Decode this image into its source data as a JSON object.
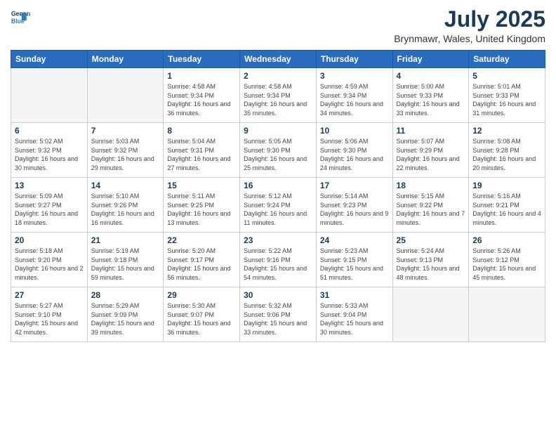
{
  "header": {
    "logo_line1": "General",
    "logo_line2": "Blue",
    "month_year": "July 2025",
    "location": "Brynmawr, Wales, United Kingdom"
  },
  "weekdays": [
    "Sunday",
    "Monday",
    "Tuesday",
    "Wednesday",
    "Thursday",
    "Friday",
    "Saturday"
  ],
  "weeks": [
    [
      {
        "day": "",
        "empty": true
      },
      {
        "day": "",
        "empty": true
      },
      {
        "day": "1",
        "sunrise": "Sunrise: 4:58 AM",
        "sunset": "Sunset: 9:34 PM",
        "daylight": "Daylight: 16 hours and 36 minutes."
      },
      {
        "day": "2",
        "sunrise": "Sunrise: 4:58 AM",
        "sunset": "Sunset: 9:34 PM",
        "daylight": "Daylight: 16 hours and 35 minutes."
      },
      {
        "day": "3",
        "sunrise": "Sunrise: 4:59 AM",
        "sunset": "Sunset: 9:34 PM",
        "daylight": "Daylight: 16 hours and 34 minutes."
      },
      {
        "day": "4",
        "sunrise": "Sunrise: 5:00 AM",
        "sunset": "Sunset: 9:33 PM",
        "daylight": "Daylight: 16 hours and 33 minutes."
      },
      {
        "day": "5",
        "sunrise": "Sunrise: 5:01 AM",
        "sunset": "Sunset: 9:33 PM",
        "daylight": "Daylight: 16 hours and 31 minutes."
      }
    ],
    [
      {
        "day": "6",
        "sunrise": "Sunrise: 5:02 AM",
        "sunset": "Sunset: 9:32 PM",
        "daylight": "Daylight: 16 hours and 30 minutes."
      },
      {
        "day": "7",
        "sunrise": "Sunrise: 5:03 AM",
        "sunset": "Sunset: 9:32 PM",
        "daylight": "Daylight: 16 hours and 29 minutes."
      },
      {
        "day": "8",
        "sunrise": "Sunrise: 5:04 AM",
        "sunset": "Sunset: 9:31 PM",
        "daylight": "Daylight: 16 hours and 27 minutes."
      },
      {
        "day": "9",
        "sunrise": "Sunrise: 5:05 AM",
        "sunset": "Sunset: 9:30 PM",
        "daylight": "Daylight: 16 hours and 25 minutes."
      },
      {
        "day": "10",
        "sunrise": "Sunrise: 5:06 AM",
        "sunset": "Sunset: 9:30 PM",
        "daylight": "Daylight: 16 hours and 24 minutes."
      },
      {
        "day": "11",
        "sunrise": "Sunrise: 5:07 AM",
        "sunset": "Sunset: 9:29 PM",
        "daylight": "Daylight: 16 hours and 22 minutes."
      },
      {
        "day": "12",
        "sunrise": "Sunrise: 5:08 AM",
        "sunset": "Sunset: 9:28 PM",
        "daylight": "Daylight: 16 hours and 20 minutes."
      }
    ],
    [
      {
        "day": "13",
        "sunrise": "Sunrise: 5:09 AM",
        "sunset": "Sunset: 9:27 PM",
        "daylight": "Daylight: 16 hours and 18 minutes."
      },
      {
        "day": "14",
        "sunrise": "Sunrise: 5:10 AM",
        "sunset": "Sunset: 9:26 PM",
        "daylight": "Daylight: 16 hours and 16 minutes."
      },
      {
        "day": "15",
        "sunrise": "Sunrise: 5:11 AM",
        "sunset": "Sunset: 9:25 PM",
        "daylight": "Daylight: 16 hours and 13 minutes."
      },
      {
        "day": "16",
        "sunrise": "Sunrise: 5:12 AM",
        "sunset": "Sunset: 9:24 PM",
        "daylight": "Daylight: 16 hours and 11 minutes."
      },
      {
        "day": "17",
        "sunrise": "Sunrise: 5:14 AM",
        "sunset": "Sunset: 9:23 PM",
        "daylight": "Daylight: 16 hours and 9 minutes."
      },
      {
        "day": "18",
        "sunrise": "Sunrise: 5:15 AM",
        "sunset": "Sunset: 9:22 PM",
        "daylight": "Daylight: 16 hours and 7 minutes."
      },
      {
        "day": "19",
        "sunrise": "Sunrise: 5:16 AM",
        "sunset": "Sunset: 9:21 PM",
        "daylight": "Daylight: 16 hours and 4 minutes."
      }
    ],
    [
      {
        "day": "20",
        "sunrise": "Sunrise: 5:18 AM",
        "sunset": "Sunset: 9:20 PM",
        "daylight": "Daylight: 16 hours and 2 minutes."
      },
      {
        "day": "21",
        "sunrise": "Sunrise: 5:19 AM",
        "sunset": "Sunset: 9:18 PM",
        "daylight": "Daylight: 15 hours and 59 minutes."
      },
      {
        "day": "22",
        "sunrise": "Sunrise: 5:20 AM",
        "sunset": "Sunset: 9:17 PM",
        "daylight": "Daylight: 15 hours and 56 minutes."
      },
      {
        "day": "23",
        "sunrise": "Sunrise: 5:22 AM",
        "sunset": "Sunset: 9:16 PM",
        "daylight": "Daylight: 15 hours and 54 minutes."
      },
      {
        "day": "24",
        "sunrise": "Sunrise: 5:23 AM",
        "sunset": "Sunset: 9:15 PM",
        "daylight": "Daylight: 15 hours and 51 minutes."
      },
      {
        "day": "25",
        "sunrise": "Sunrise: 5:24 AM",
        "sunset": "Sunset: 9:13 PM",
        "daylight": "Daylight: 15 hours and 48 minutes."
      },
      {
        "day": "26",
        "sunrise": "Sunrise: 5:26 AM",
        "sunset": "Sunset: 9:12 PM",
        "daylight": "Daylight: 15 hours and 45 minutes."
      }
    ],
    [
      {
        "day": "27",
        "sunrise": "Sunrise: 5:27 AM",
        "sunset": "Sunset: 9:10 PM",
        "daylight": "Daylight: 15 hours and 42 minutes."
      },
      {
        "day": "28",
        "sunrise": "Sunrise: 5:29 AM",
        "sunset": "Sunset: 9:09 PM",
        "daylight": "Daylight: 15 hours and 39 minutes."
      },
      {
        "day": "29",
        "sunrise": "Sunrise: 5:30 AM",
        "sunset": "Sunset: 9:07 PM",
        "daylight": "Daylight: 15 hours and 36 minutes."
      },
      {
        "day": "30",
        "sunrise": "Sunrise: 5:32 AM",
        "sunset": "Sunset: 9:06 PM",
        "daylight": "Daylight: 15 hours and 33 minutes."
      },
      {
        "day": "31",
        "sunrise": "Sunrise: 5:33 AM",
        "sunset": "Sunset: 9:04 PM",
        "daylight": "Daylight: 15 hours and 30 minutes."
      },
      {
        "day": "",
        "empty": true
      },
      {
        "day": "",
        "empty": true
      }
    ]
  ]
}
